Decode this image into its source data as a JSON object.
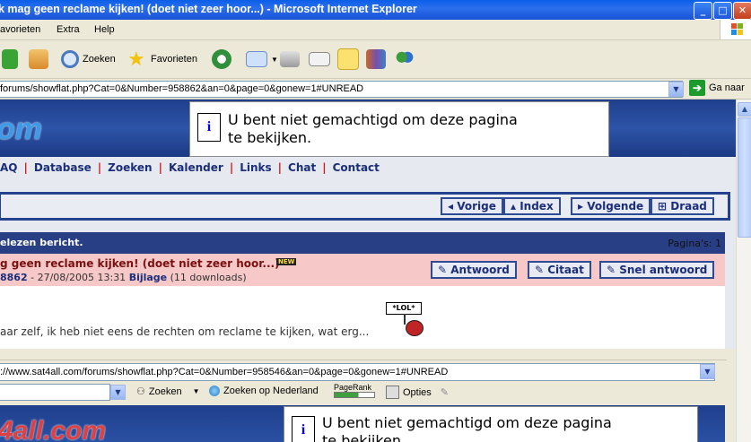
{
  "window": {
    "title": "k mag geen reclame kijken! (doet niet zeer hoor...) - Microsoft Internet Explorer",
    "buttons": {
      "minimize": "_",
      "maximize": "□",
      "close": "✕"
    }
  },
  "menu": [
    "avorieten",
    "Extra",
    "Help"
  ],
  "toolbar": {
    "search": "Zoeken",
    "favorites": "Favorieten"
  },
  "address": {
    "url": "forums/showflat.php?Cat=0&Number=958862&an=0&page=0&gonew=1#UNREAD",
    "go": "Ga naar"
  },
  "page": {
    "logo": "om",
    "blocked_msg_1": "U bent niet gemachtigd om deze pagina",
    "blocked_msg_2": "te bekijken.",
    "nav": [
      "AQ",
      "Database",
      "Zoeken",
      "Kalender",
      "Links",
      "Chat",
      "Contact"
    ],
    "thread_nav": {
      "prev": "Vorige",
      "index": "Index",
      "next": "Volgende",
      "thread": "Draad"
    },
    "post_header_left": "elezen bericht.",
    "post_header_right": "Pagina's: 1",
    "post_title": "g geen reclame kijken! (doet niet zeer hoor...)",
    "new_badge": "NEW",
    "post_meta_id": "8862",
    "post_meta_date": " - 27/08/2005 13:31 ",
    "post_meta_attach": "Bijlage",
    "post_meta_dl": " (11 downloads)",
    "post_actions": {
      "reply": "Antwoord",
      "quote": "Citaat",
      "quick": "Snel antwoord"
    },
    "post_text": "aar zelf, ik heb niet eens de rechten om reclame te kijken, wat erg...",
    "sign_text": "*LOL*"
  },
  "inner": {
    "url": "://www.sat4all.com/forums/showflat.php?Cat=0&Number=958546&an=0&page=0&gonew=1#UNREAD",
    "search": "Zoeken",
    "search_nl": "Zoeken op Nederland",
    "pagerank": "PageRank",
    "options": "Opties",
    "logo": "4all.com",
    "blocked_msg_1": "U bent niet gemachtigd om deze pagina",
    "blocked_msg_2": "te bekijken."
  }
}
